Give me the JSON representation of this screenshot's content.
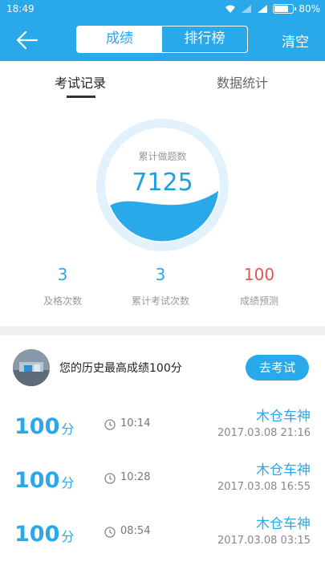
{
  "status_bar": {
    "time": "18:49",
    "battery": "80%",
    "battery_level": 0.8
  },
  "header": {
    "tabs": [
      "成绩",
      "排行榜"
    ],
    "active_tab": "成绩",
    "clear_label": "清空"
  },
  "sub_tabs": {
    "tab1": "考试记录",
    "tab2": "数据统计"
  },
  "gauge": {
    "label": "累计做题数",
    "value": "7125",
    "fill_fraction": 0.35
  },
  "stats": [
    {
      "value": "3",
      "label": "及格次数"
    },
    {
      "value": "3",
      "label": "累计考试次数"
    },
    {
      "value": "100",
      "label": "成绩预测"
    }
  ],
  "best": {
    "text": "您的历史最高成绩100分",
    "button": "去考试"
  },
  "records": [
    {
      "score": "100",
      "unit": "分",
      "duration": "10:14",
      "name": "木仓车神",
      "datetime": "2017.03.08  21:16"
    },
    {
      "score": "100",
      "unit": "分",
      "duration": "10:28",
      "name": "木仓车神",
      "datetime": "2017.03.08  16:55"
    },
    {
      "score": "100",
      "unit": "分",
      "duration": "08:54",
      "name": "木仓车神",
      "datetime": "2017.03.08  03:15"
    }
  ],
  "colors": {
    "primary": "#29a8ea",
    "accent_red": "#e8544e"
  }
}
